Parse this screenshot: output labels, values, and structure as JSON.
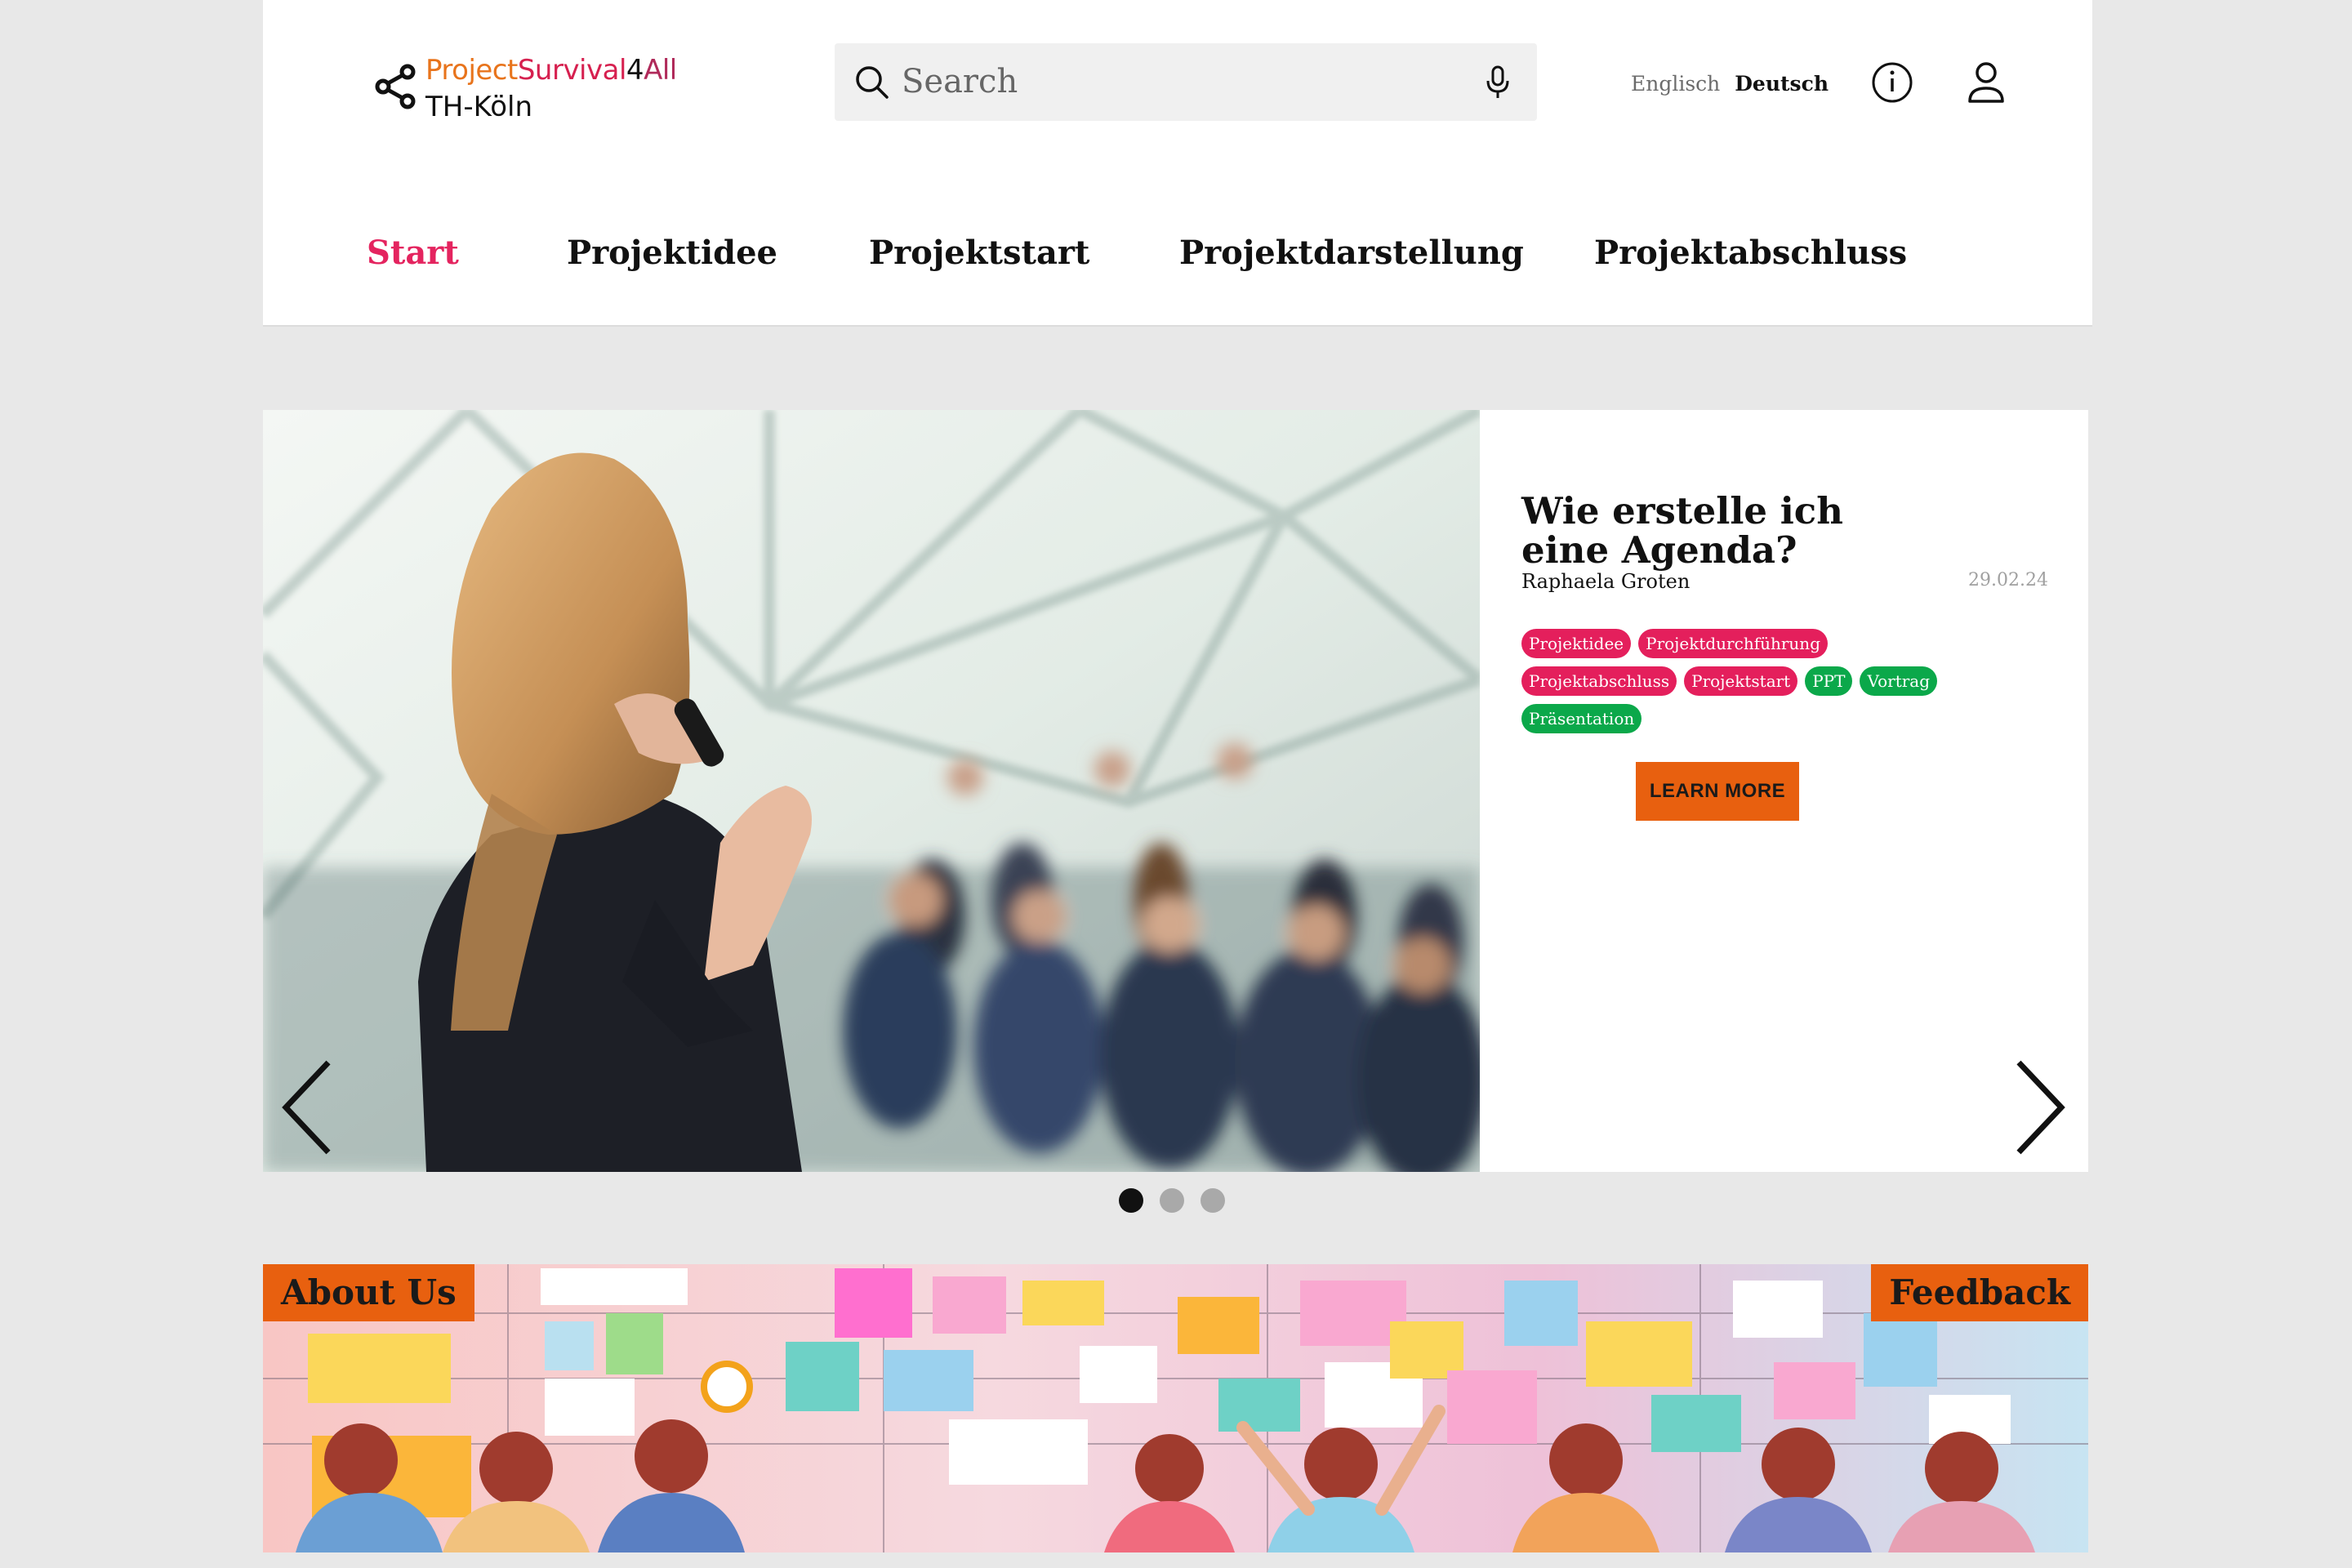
{
  "brand": {
    "name_part1": "Project",
    "name_part2": "Survival",
    "name_part3": "4",
    "name_part4": "All",
    "subtitle": "TH-Köln"
  },
  "search": {
    "placeholder": "Search"
  },
  "language": {
    "english": "Englisch",
    "german": "Deutsch"
  },
  "nav": {
    "items": [
      {
        "label": "Start",
        "active": true
      },
      {
        "label": "Projektidee"
      },
      {
        "label": "Projektstart"
      },
      {
        "label": "Projektdarstellung"
      },
      {
        "label": "Projektabschluss"
      }
    ]
  },
  "hero": {
    "title": "Wie erstelle ich eine Agenda?",
    "author": "Raphaela Groten",
    "date": "29.02.24",
    "tags": [
      {
        "label": "Projektidee",
        "color": "#e41f5c"
      },
      {
        "label": "Projektdurchführung",
        "color": "#e41f5c"
      },
      {
        "label": "Projektabschluss",
        "color": "#e41f5c"
      },
      {
        "label": "Projektstart",
        "color": "#e41f5c"
      },
      {
        "label": "PPT",
        "color": "#0ba84a"
      },
      {
        "label": "Vortrag",
        "color": "#0ba84a"
      },
      {
        "label": "Präsentation",
        "color": "#0ba84a"
      }
    ],
    "cta": "LEARN MORE",
    "slides_total": 3,
    "slide_active": 1
  },
  "banner": {
    "about": "About Us",
    "feedback": "Feedback"
  },
  "colors": {
    "accent": "#e4245f",
    "orange": "#e8600f",
    "green": "#0ba84a"
  }
}
